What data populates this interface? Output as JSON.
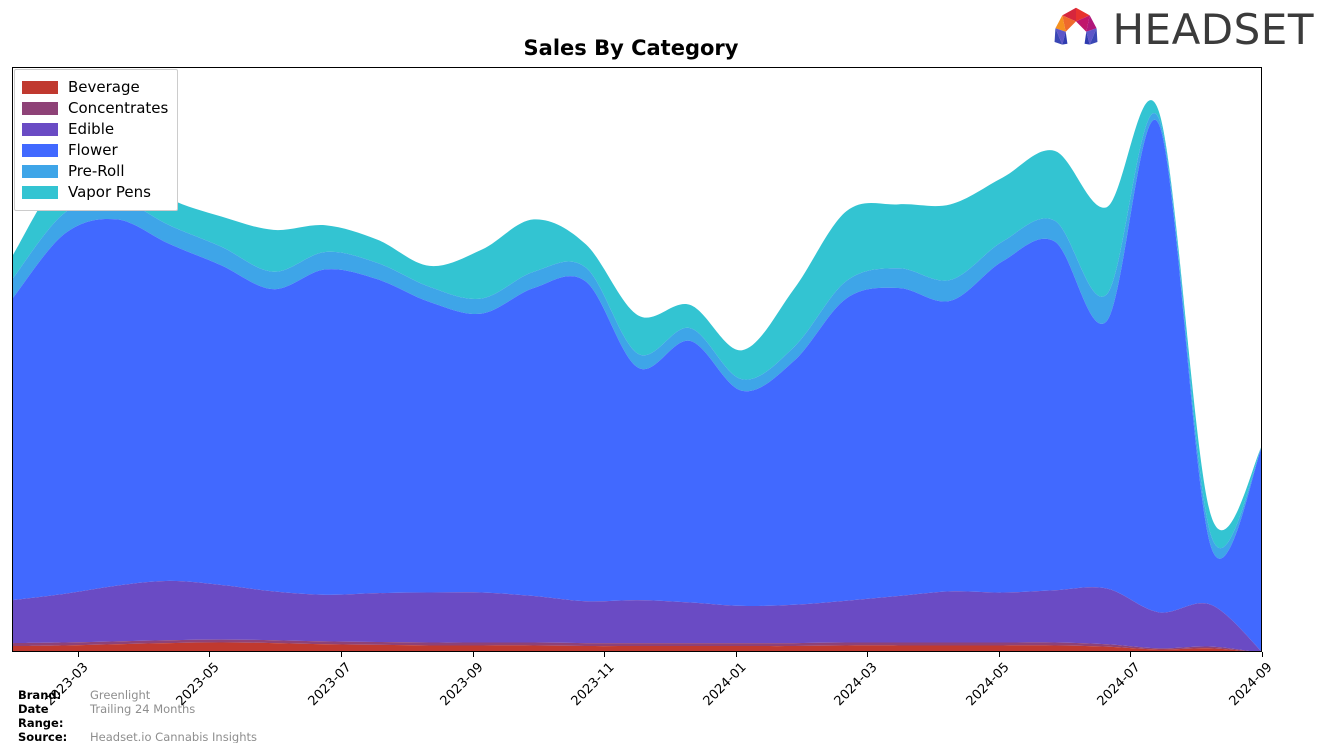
{
  "header": {
    "logo_text": "HEADSET",
    "logo_mark_name": "headset-arch-logo"
  },
  "title": "Sales By Category",
  "footer": {
    "brand_key": "Brand:",
    "brand_value": "Greenlight",
    "date_range_key": "Date Range:",
    "date_range_value": "Trailing 24 Months",
    "source_key": "Source:",
    "source_value": "Headset.io Cannabis Insights"
  },
  "colors": {
    "beverage": "#c0392f",
    "concentrates": "#8e4277",
    "edible": "#6a4bc4",
    "flower": "#4169ff",
    "preroll": "#3ea5e8",
    "vaporpens": "#33c4d2",
    "frame": "#000000",
    "legend_border": "#cccccc",
    "footer_value": "#8e8e8e",
    "logo_text": "#3b3b3b"
  },
  "legend": {
    "items": [
      {
        "label": "Beverage",
        "key": "beverage"
      },
      {
        "label": "Concentrates",
        "key": "concentrates"
      },
      {
        "label": "Edible",
        "key": "edible"
      },
      {
        "label": "Flower",
        "key": "flower"
      },
      {
        "label": "Pre-Roll",
        "key": "preroll"
      },
      {
        "label": "Vapor Pens",
        "key": "vaporpens"
      }
    ]
  },
  "chart_data": {
    "type": "area",
    "stacked": true,
    "smoothing": "spline",
    "title": "Sales By Category",
    "xlabel": "",
    "ylabel": "",
    "grid": false,
    "legend_position": "top-left",
    "axis_y_visible": false,
    "x_tick_labels": [
      "2023-03",
      "2023-05",
      "2023-07",
      "2023-09",
      "2023-11",
      "2024-01",
      "2024-03",
      "2024-05",
      "2024-07",
      "2024-09"
    ],
    "x_tick_positions_frac": [
      0.0526,
      0.1579,
      0.2632,
      0.3684,
      0.4737,
      0.5789,
      0.6842,
      0.7895,
      0.8947,
      1.0
    ],
    "x": [
      "2022-11",
      "2022-12",
      "2023-01",
      "2023-02",
      "2023-03",
      "2023-04",
      "2023-05",
      "2023-06",
      "2023-07",
      "2023-08",
      "2023-09",
      "2023-10",
      "2023-11",
      "2023-12",
      "2024-01",
      "2024-02",
      "2024-03",
      "2024-04",
      "2024-05",
      "2024-06",
      "2024-07",
      "2024-08",
      "2024-09",
      "2024-10"
    ],
    "ylim": [
      0,
      100
    ],
    "series": [
      {
        "name": "Beverage",
        "key": "beverage",
        "values": [
          1.2,
          1.3,
          1.5,
          1.7,
          1.8,
          1.7,
          1.5,
          1.4,
          1.3,
          1.3,
          1.3,
          1.2,
          1.2,
          1.2,
          1.2,
          1.2,
          1.3,
          1.3,
          1.3,
          1.3,
          1.3,
          1.1,
          0.6,
          0.8
        ]
      },
      {
        "name": "Concentrates",
        "key": "concentrates",
        "values": [
          0.5,
          0.5,
          0.5,
          0.5,
          0.5,
          0.5,
          0.5,
          0.5,
          0.5,
          0.5,
          0.5,
          0.5,
          0.5,
          0.5,
          0.5,
          0.5,
          0.5,
          0.5,
          0.5,
          0.5,
          0.5,
          0.4,
          0.2,
          0.3
        ]
      },
      {
        "name": "Edible",
        "key": "edible",
        "values": [
          7.4,
          8.4,
          9.6,
          10.2,
          9.4,
          8.4,
          8.0,
          8.4,
          8.6,
          8.6,
          8.0,
          7.2,
          7.4,
          7.0,
          6.4,
          6.6,
          7.2,
          8.0,
          8.8,
          8.6,
          9.0,
          9.6,
          6.2,
          7.2
        ]
      },
      {
        "name": "Flower",
        "key": "flower",
        "values": [
          52.0,
          62.0,
          63.0,
          58.0,
          55.0,
          52.0,
          56.0,
          54.0,
          50.0,
          48.0,
          53.0,
          55.0,
          40.0,
          45.0,
          37.0,
          42.0,
          52.0,
          53.0,
          50.0,
          57.0,
          60.0,
          46.0,
          84.0,
          10.0,
          36.0
        ]
      },
      {
        "name": "Pre-Roll",
        "key": "preroll",
        "values": [
          3.4,
          3.6,
          3.4,
          3.2,
          3.2,
          3.0,
          3.0,
          2.8,
          2.6,
          2.6,
          2.8,
          2.4,
          2.4,
          2.2,
          2.0,
          2.4,
          3.0,
          3.4,
          3.6,
          3.4,
          3.6,
          4.6,
          1.0,
          2.0
        ]
      },
      {
        "name": "Vapor Pens",
        "key": "vaporpens",
        "values": [
          4.0,
          7.0,
          6.0,
          4.6,
          5.2,
          7.2,
          4.6,
          4.0,
          3.6,
          8.4,
          9.0,
          4.0,
          6.6,
          4.0,
          5.0,
          10.0,
          12.0,
          11.0,
          13.0,
          11.0,
          12.0,
          15.0,
          1.2,
          3.4
        ]
      }
    ]
  }
}
